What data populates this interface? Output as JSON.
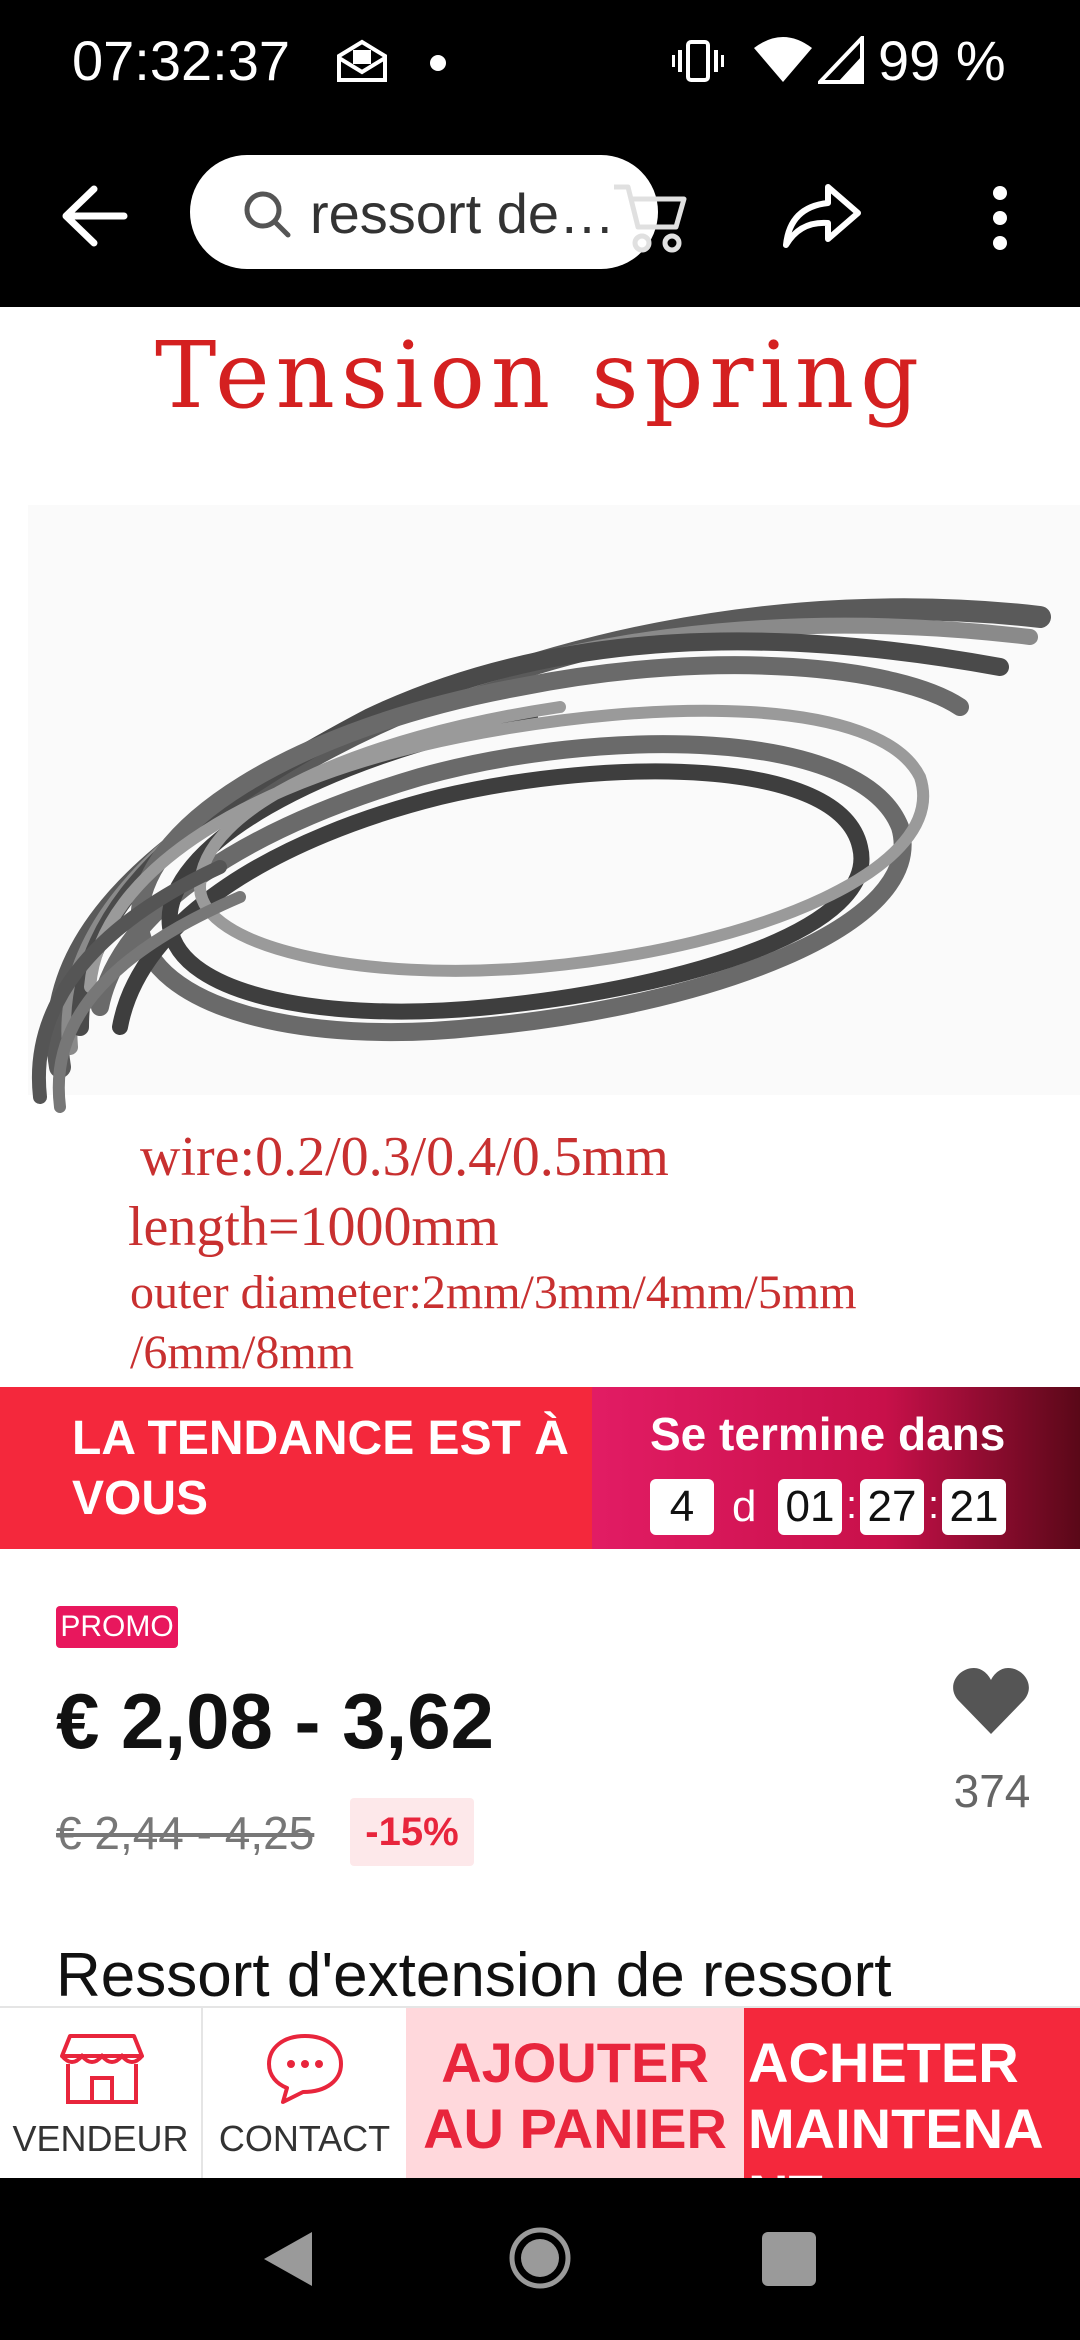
{
  "status_bar": {
    "time": "07:32:37",
    "battery": "99 %"
  },
  "toolbar": {
    "search_text": "ressort de…"
  },
  "product_image": {
    "title": "Tension spring",
    "wire": "wire:0.2/0.3/0.4/0.5mm",
    "length": "length=1000mm",
    "outer_diameter": "outer diameter:2mm/3mm/4mm/5mm",
    "outer_diameter_cont": "/6mm/8mm"
  },
  "banner": {
    "trend_text": "LA TENDANCE EST À VOUS",
    "ends_label": "Se termine dans",
    "days": "4",
    "days_unit": "d",
    "hours": "01",
    "minutes": "27",
    "seconds": "21"
  },
  "price": {
    "promo_label": "PROMO",
    "current": "€ 2,08 - 3,62",
    "original": "€ 2,44 - 4,25",
    "discount": "-15%",
    "wishlist_count": "374"
  },
  "product_title": "Ressort d'extension de ressort",
  "action_bar": {
    "vendor_label": "VENDEUR",
    "contact_label": "CONTACT",
    "add_to_cart": "AJOUTER AU PANIER",
    "buy_now": "ACHETER MAINTENANT"
  },
  "colors": {
    "accent": "#f4283c",
    "promo": "#e8175d",
    "add_bg": "#ffd8dc"
  }
}
